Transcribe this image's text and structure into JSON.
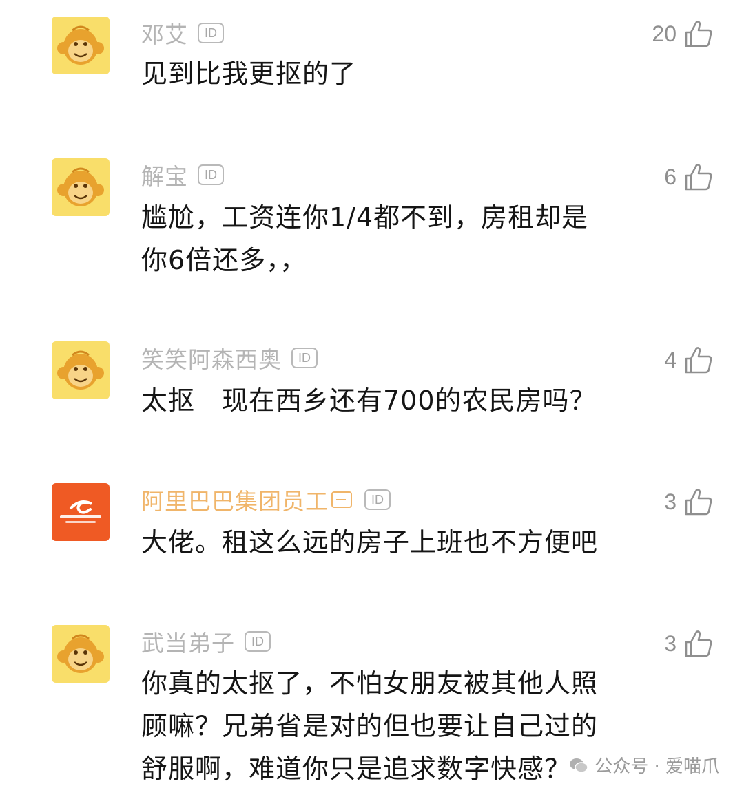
{
  "comments": [
    {
      "name": "邓艾",
      "id_badge": "ID",
      "likes": "20",
      "text": "见到比我更抠的了",
      "avatar": "monkey-avatar"
    },
    {
      "name": "解宝",
      "id_badge": "ID",
      "likes": "6",
      "text": "尴尬，工资连你1/4都不到，房租却是你6倍还多，，",
      "avatar": "monkey-avatar"
    },
    {
      "name": "笑笑阿森西奥",
      "id_badge": "ID",
      "likes": "4",
      "text": "太抠　现在西乡还有700的农民房吗？",
      "avatar": "monkey-avatar"
    },
    {
      "name": "阿里巴巴集团员工",
      "id_badge": "ID",
      "likes": "3",
      "text": "大佬。租这么远的房子上班也不方便吧",
      "avatar": "alibaba-logo",
      "verified": true
    },
    {
      "name": "武当弟子",
      "id_badge": "ID",
      "likes": "3",
      "text": "你真的太抠了，不怕女朋友被其他人照顾嘛？兄弟省是对的但也要让自己过的舒服啊，难道你只是追求数字快感？",
      "avatar": "monkey-avatar"
    }
  ],
  "watermark": {
    "text": "公众号 · 爱喵爪"
  },
  "colors": {
    "name": "#b4b4b4",
    "verified_name": "#f0b56a",
    "avatar_bg": "#f9de6a",
    "alibaba_bg": "#ef5a24"
  }
}
